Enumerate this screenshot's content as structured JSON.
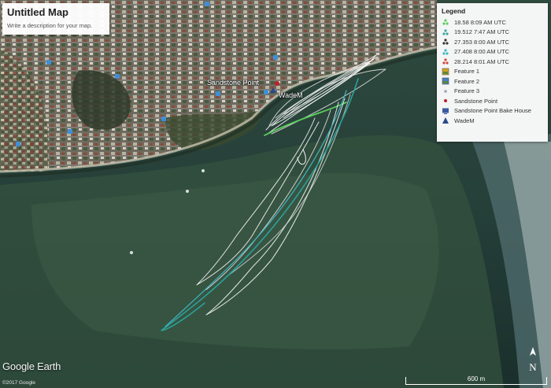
{
  "map": {
    "title": "Untitled Map",
    "description": "Write a description for your map.",
    "places": {
      "sandstone_point": "Sandstone Point",
      "wade_m": "WadeM"
    }
  },
  "legend": {
    "title": "Legend",
    "items": [
      {
        "label": "18.58 8:09 AM UTC",
        "icon": "track-icon",
        "color": "#5ccf5c"
      },
      {
        "label": "19.512 7:47 AM UTC",
        "icon": "track-icon",
        "color": "#3aa8a0"
      },
      {
        "label": "27.353 8:00 AM UTC",
        "icon": "track-icon",
        "color": "#333333"
      },
      {
        "label": "27.408 8:00 AM UTC",
        "icon": "track-icon",
        "color": "#3fb6c4"
      },
      {
        "label": "28.214 8:01 AM UTC",
        "icon": "track-icon",
        "color": "#d04a3a"
      },
      {
        "label": "Feature 1",
        "icon": "image-overlay-icon",
        "color": "#d4a020"
      },
      {
        "label": "Feature 2",
        "icon": "image-overlay-icon",
        "color": "#4a7fc4"
      },
      {
        "label": "Feature 3",
        "icon": "point-icon",
        "color": "#9aa6b4"
      },
      {
        "label": "Sandstone Point",
        "icon": "pin-icon",
        "color": "#c0202a"
      },
      {
        "label": "Sandstone Point Bake House",
        "icon": "screen-icon",
        "color": "#3a5aa0"
      },
      {
        "label": "WadeM",
        "icon": "triangle-icon",
        "color": "#2a4a8a"
      }
    ]
  },
  "footer": {
    "logo": "Google Earth",
    "copyright": "©2017 Google",
    "scale": "600 m",
    "compass": "N"
  }
}
